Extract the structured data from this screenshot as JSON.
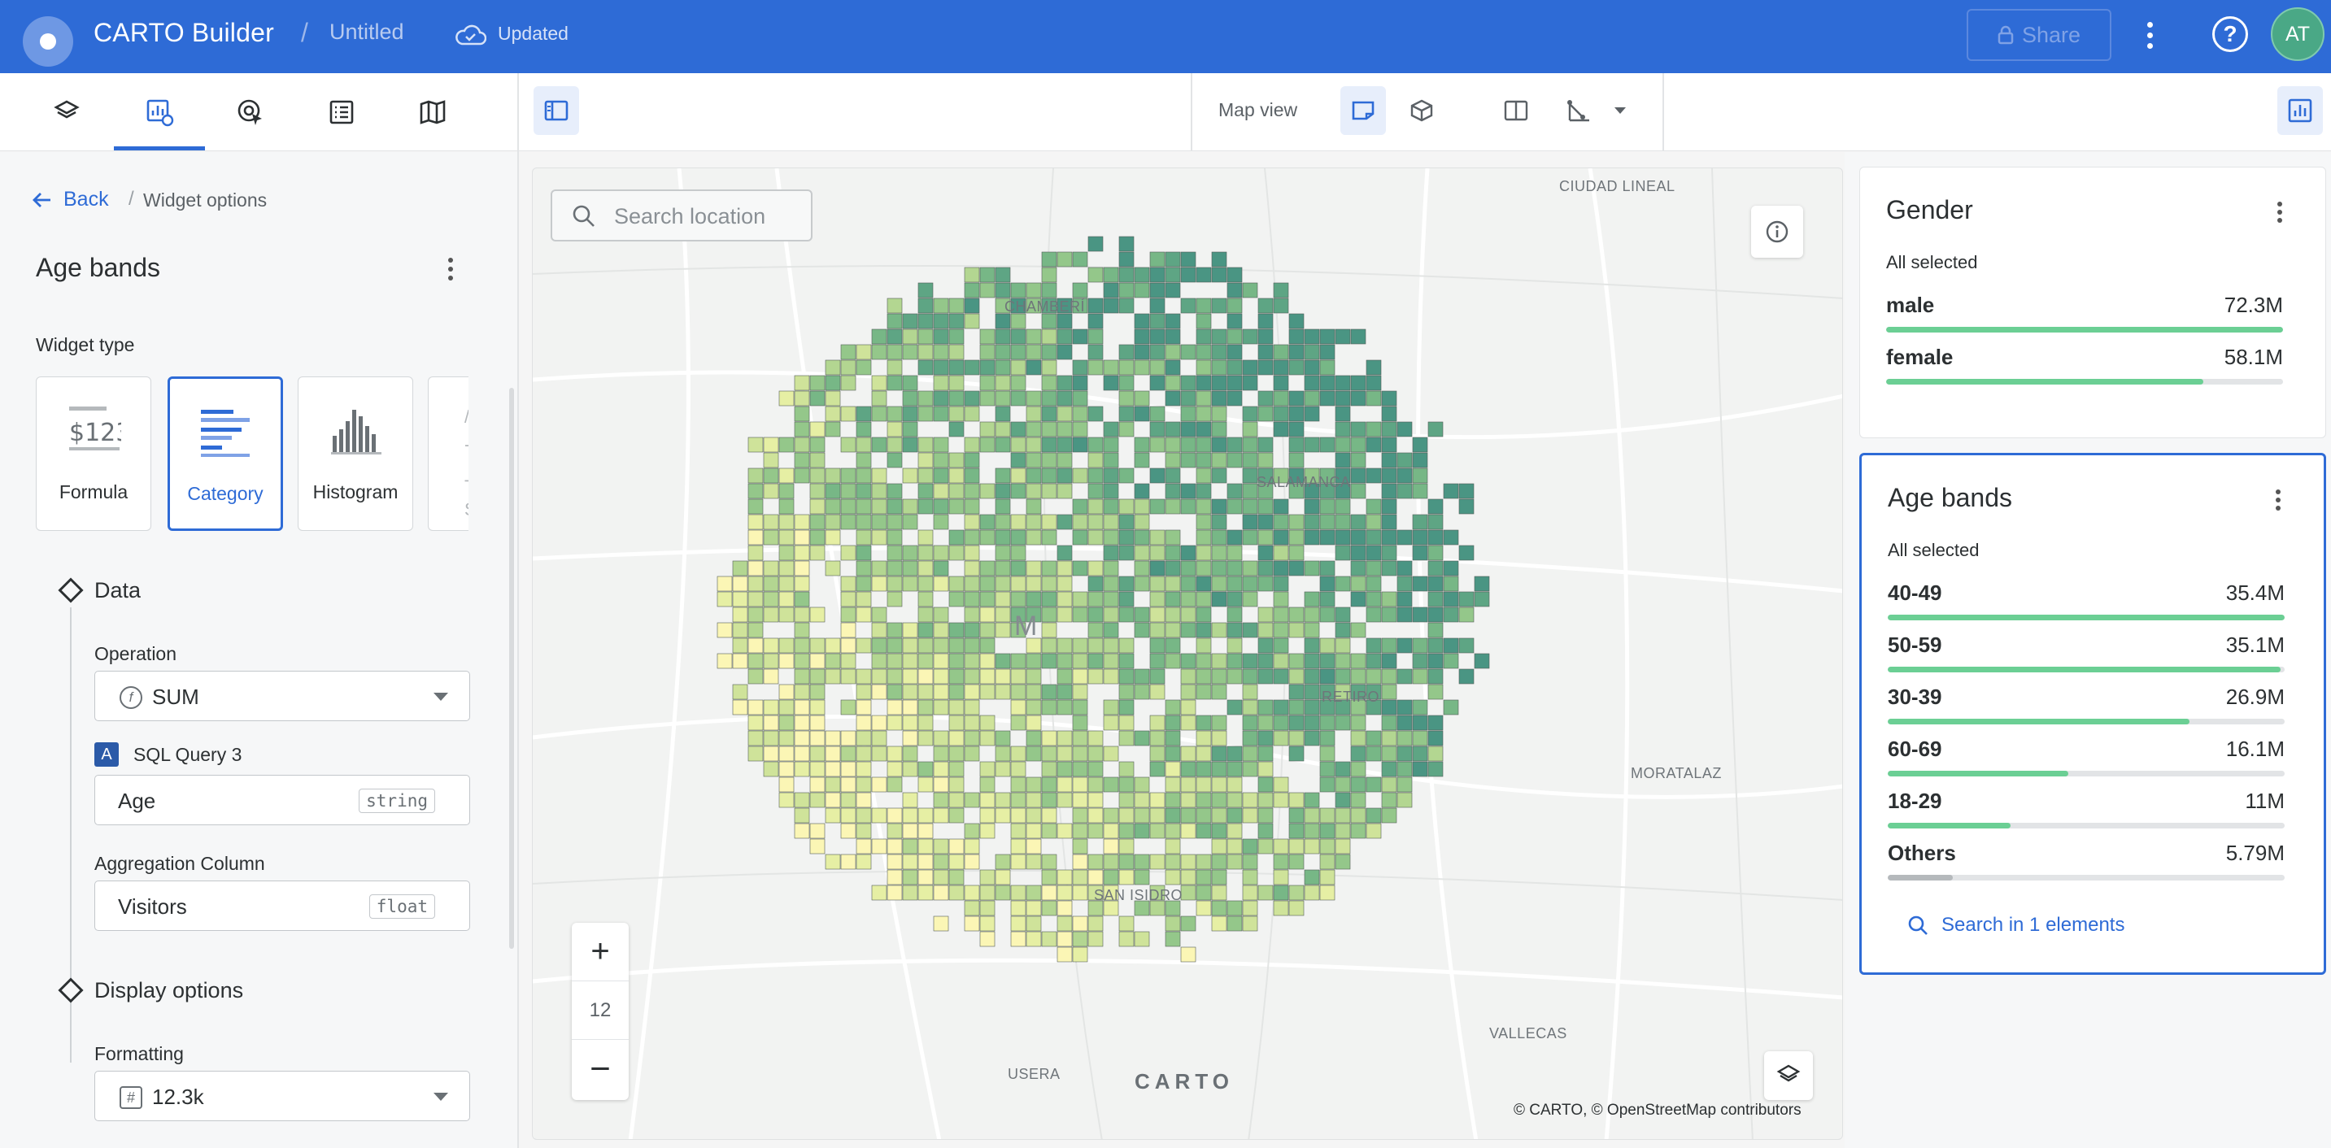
{
  "header": {
    "app_title": "CARTO Builder",
    "separator": "/",
    "map_title": "Untitled",
    "status": "Updated",
    "share_label": "Share",
    "avatar_initials": "AT",
    "accent_color": "#2e6bd6"
  },
  "toolbar": {
    "tabs": [
      "layers-icon",
      "widgets-icon",
      "interactions-icon",
      "legend-icon",
      "basemap-icon"
    ],
    "map_view_label": "Map view"
  },
  "left_panel": {
    "back_label": "Back",
    "breadcrumb_sep": "/",
    "breadcrumb_current": "Widget options",
    "widget_title": "Age bands",
    "widget_type_label": "Widget type",
    "widget_types": [
      {
        "label": "Formula",
        "icon_text": "$123"
      },
      {
        "label": "Category"
      },
      {
        "label": "Histogram"
      },
      {
        "label": "",
        "ghost_top": "/",
        "ghost_mid": "-",
        "ghost_a": "T",
        "ghost_b": "S"
      }
    ],
    "data_section": "Data",
    "operation_label": "Operation",
    "operation_value": "SUM",
    "source_badge": "A",
    "source_name": "SQL Query 3",
    "column_value": "Age",
    "column_type": "string",
    "aggregation_label": "Aggregation Column",
    "aggregation_value": "Visitors",
    "aggregation_type": "float",
    "display_section": "Display options",
    "formatting_label": "Formatting",
    "formatting_value": "12.3k"
  },
  "map": {
    "search_placeholder": "Search location",
    "zoom_in": "+",
    "zoom_level": "12",
    "zoom_out": "−",
    "carto_logo": "CARTO",
    "attribution": "© CARTO, © OpenStreetMap contributors",
    "place_labels": [
      "CIUDAD LINEAL",
      "SALAMANCA",
      "RETIRO",
      "MORATALAZ",
      "VALLECAS",
      "USERA",
      "CHAMBERÍ",
      "SAN ISIDRO",
      "M"
    ]
  },
  "widgets": {
    "gender": {
      "title": "Gender",
      "subtitle": "All selected",
      "rows": [
        {
          "name": "male",
          "value": "72.3M",
          "fraction": 1.0
        },
        {
          "name": "female",
          "value": "58.1M",
          "fraction": 0.8
        }
      ]
    },
    "age_bands": {
      "title": "Age bands",
      "subtitle": "All selected",
      "rows": [
        {
          "name": "40-49",
          "value": "35.4M",
          "fraction": 1.0
        },
        {
          "name": "50-59",
          "value": "35.1M",
          "fraction": 0.99
        },
        {
          "name": "30-39",
          "value": "26.9M",
          "fraction": 0.76
        },
        {
          "name": "60-69",
          "value": "16.1M",
          "fraction": 0.455
        },
        {
          "name": "18-29",
          "value": "11M",
          "fraction": 0.31
        },
        {
          "name": "Others",
          "value": "5.79M",
          "fraction": 0.164
        }
      ],
      "search_label": "Search in 1 elements"
    }
  }
}
